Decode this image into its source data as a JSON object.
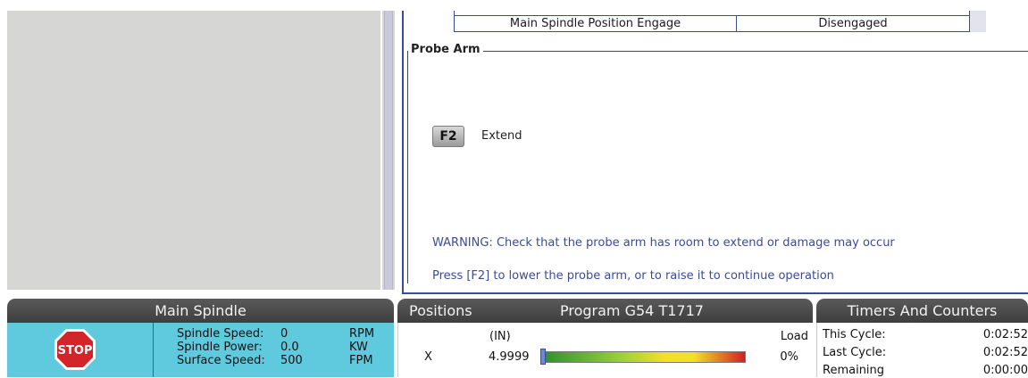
{
  "settings_table": {
    "row_label": "Main Spindle Position Engage",
    "row_value": "Disengaged"
  },
  "probe_arm": {
    "title": "Probe Arm",
    "fkey": "F2",
    "fkey_label": "Extend",
    "warning": "WARNING: Check that the probe arm has room to extend or damage may occur",
    "instruction": "Press [F2] to lower the probe arm, or to raise it to continue operation"
  },
  "main_spindle": {
    "title": "Main Spindle",
    "stop_label": "STOP",
    "rows": [
      {
        "label": "Spindle Speed:",
        "value": "0",
        "unit": "RPM"
      },
      {
        "label": "Spindle Power:",
        "value": "0.0",
        "unit": "KW"
      },
      {
        "label": "Surface Speed:",
        "value": "500",
        "unit": "FPM"
      }
    ]
  },
  "positions": {
    "title": "Positions",
    "program": "Program G54 T1717",
    "units": "(IN)",
    "load_label": "Load",
    "axis": "X",
    "axis_value": "4.9999",
    "load_value": "0%",
    "load_fraction": 0.0
  },
  "timers": {
    "title": "Timers And Counters",
    "rows": [
      {
        "label": "This Cycle:",
        "value": "0:02:52"
      },
      {
        "label": "Last Cycle:",
        "value": "0:02:52"
      },
      {
        "label": "Remaining",
        "value": "0:00:00"
      }
    ]
  },
  "colors": {
    "accent_blue": "#3a4a9c",
    "spindle_bg": "#5fc9de",
    "header_bg": "#4a4a4a",
    "stop_red": "#d3242a"
  }
}
